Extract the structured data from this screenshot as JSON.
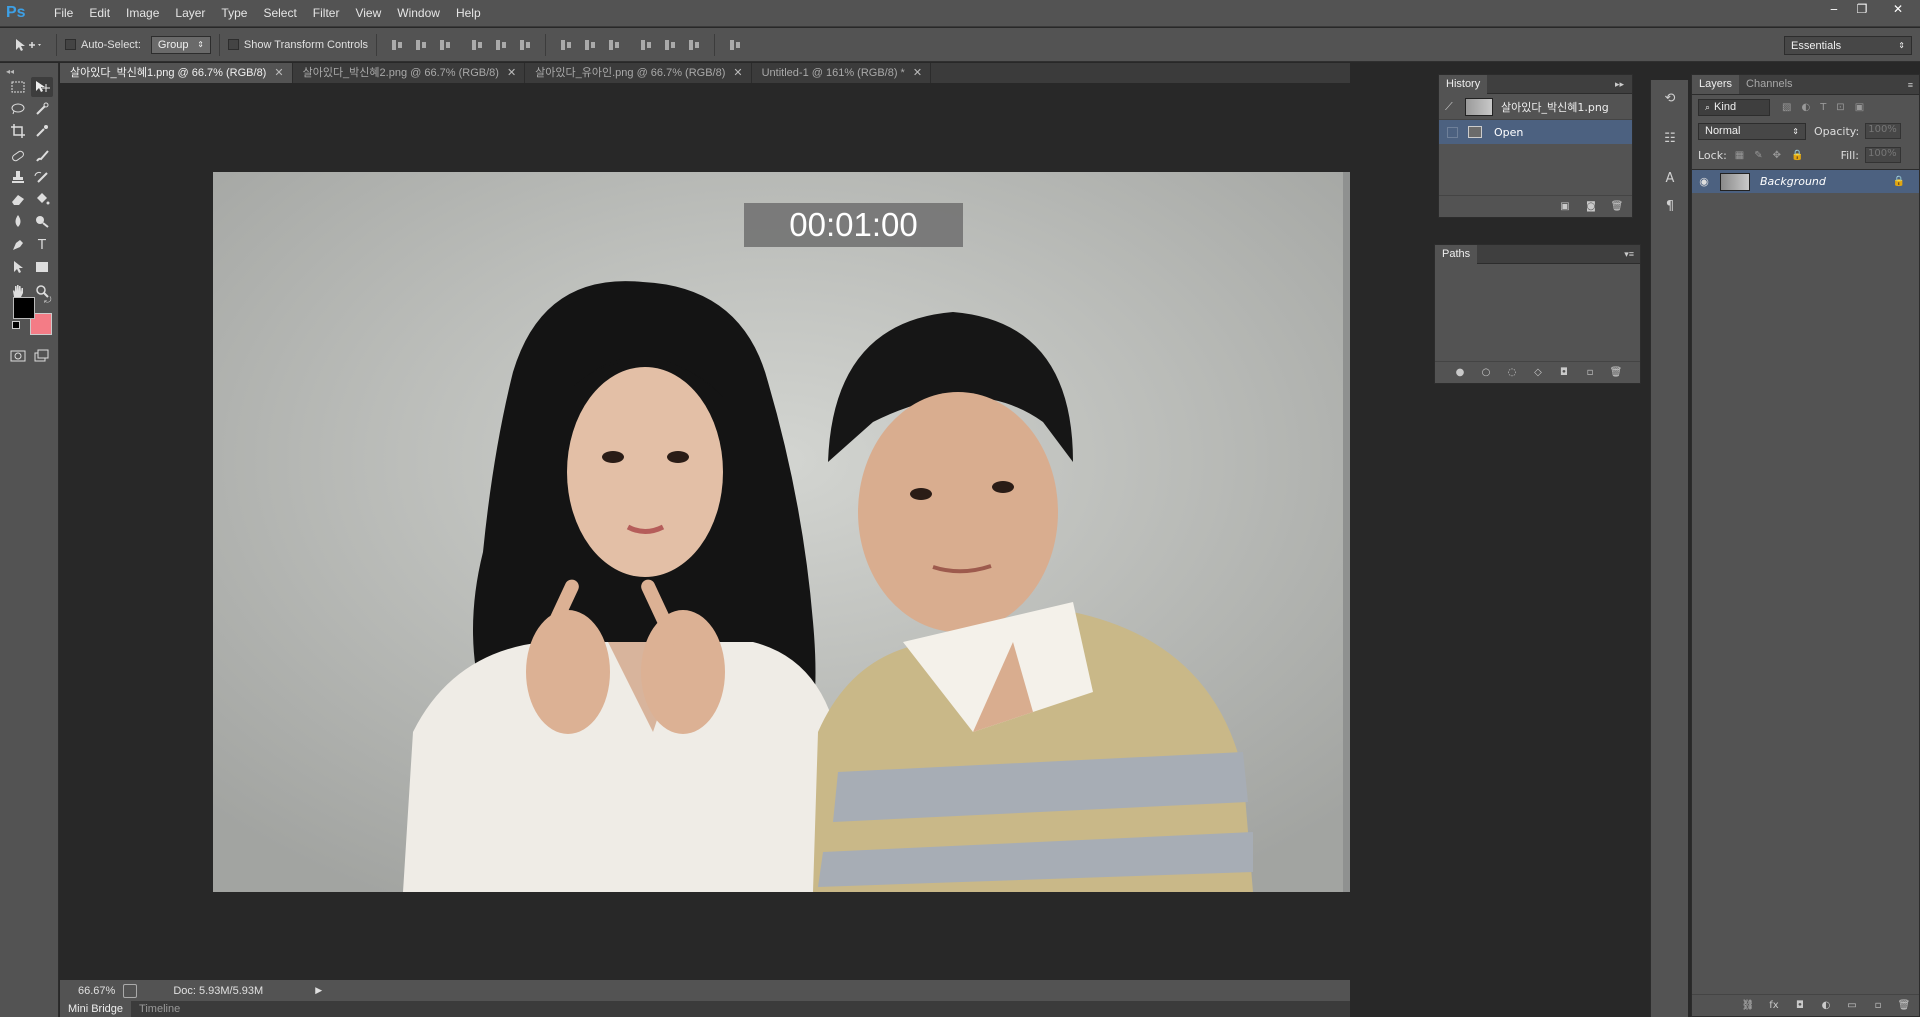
{
  "app": {
    "logo": "Ps",
    "menus": [
      "File",
      "Edit",
      "Image",
      "Layer",
      "Type",
      "Select",
      "Filter",
      "View",
      "Window",
      "Help"
    ],
    "window_controls": [
      "‒",
      "❐",
      "✕"
    ]
  },
  "options": {
    "auto_select_label": "Auto-Select:",
    "auto_select_value": "Group",
    "show_transform_label": "Show Transform Controls",
    "workspace": "Essentials"
  },
  "tabs": [
    {
      "label": "살아있다_박신혜1.png @ 66.7% (RGB/8)",
      "active": true
    },
    {
      "label": "살아있다_박신혜2.png @ 66.7% (RGB/8)",
      "active": false
    },
    {
      "label": "살아있다_유아인.png @ 66.7% (RGB/8)",
      "active": false
    },
    {
      "label": "Untitled-1 @ 161% (RGB/8) *",
      "active": false
    }
  ],
  "canvas": {
    "timer": "00:01:00"
  },
  "status": {
    "zoom": "66.67%",
    "doc": "Doc: 5.93M/5.93M"
  },
  "bottom_tabs": [
    "Mini Bridge",
    "Timeline"
  ],
  "history": {
    "title": "History",
    "snapshot": "살아있다_박신혜1.png",
    "items": [
      "Open"
    ]
  },
  "paths": {
    "title": "Paths"
  },
  "layers": {
    "tabs": [
      "Layers",
      "Channels"
    ],
    "kind": "Kind",
    "blend": "Normal",
    "opacity_label": "Opacity:",
    "opacity_value": "100%",
    "lock_label": "Lock:",
    "fill_label": "Fill:",
    "fill_value": "100%",
    "items": [
      {
        "name": "Background"
      }
    ]
  },
  "colors": {
    "foreground": "#000000",
    "background": "#f47c86",
    "record": "#e6252a",
    "selected_row": "#4c6180"
  }
}
